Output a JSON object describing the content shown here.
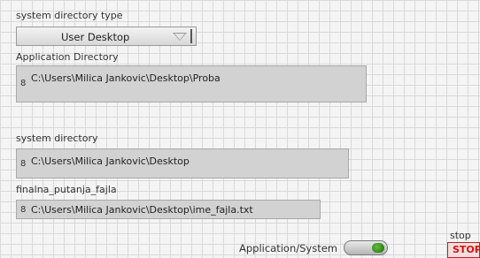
{
  "dir_type": {
    "label": "system directory type",
    "value": "User Desktop"
  },
  "app_dir": {
    "label": "Application Directory",
    "icon": "path-icon",
    "value": "C:\\Users\\Milica Jankovic\\Desktop\\Proba"
  },
  "sys_dir": {
    "label": "system directory",
    "icon": "path-icon",
    "value": "C:\\Users\\Milica Jankovic\\Desktop"
  },
  "final_path": {
    "label": "finalna_putanja_fajla",
    "icon": "path-icon",
    "value": "C:\\Users\\Milica Jankovic\\Desktop\\ime_fajla.txt"
  },
  "toggle": {
    "label": "Application/System",
    "state": "on"
  },
  "stop": {
    "label": "stop",
    "button": "STOP"
  },
  "path_glyph": "8",
  "colors": {
    "grid": "#d9d9d9",
    "stop_red": "#d11111",
    "led_green": "#3fa52a"
  }
}
